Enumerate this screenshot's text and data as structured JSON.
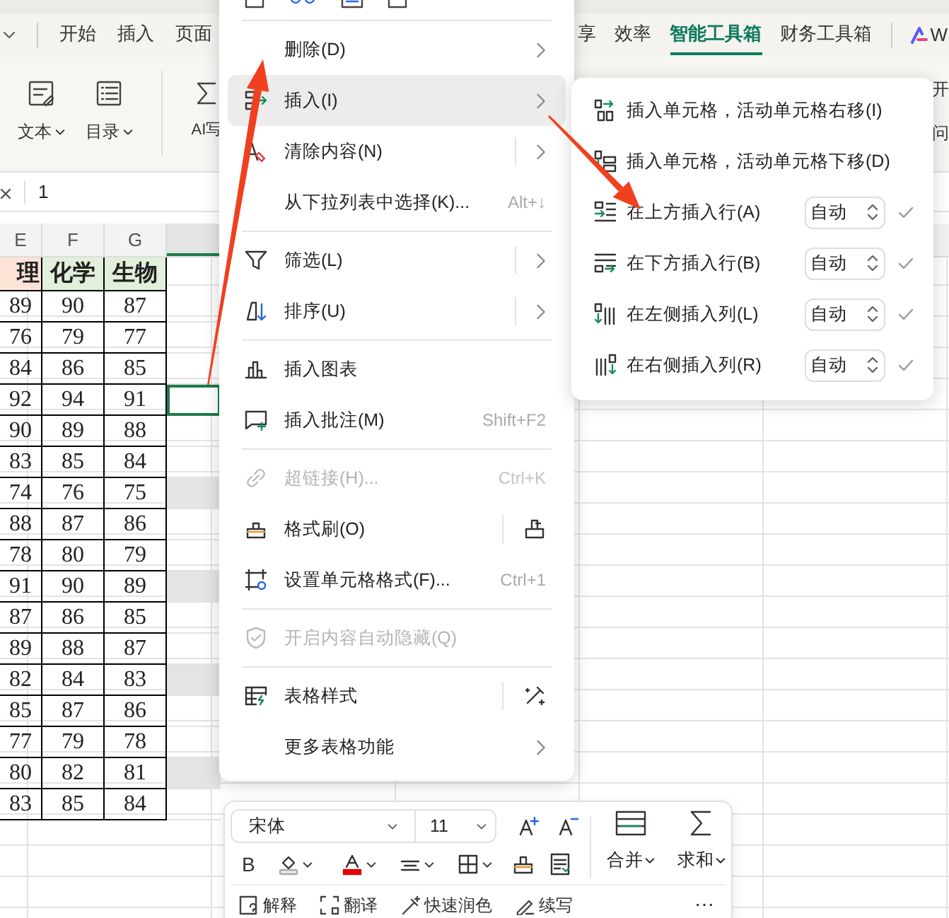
{
  "ribbon_tabs": [
    {
      "label": "开始",
      "selected": false,
      "kind": "tab"
    },
    {
      "label": "插入",
      "selected": false,
      "kind": "tab"
    },
    {
      "label": "页面",
      "selected": false,
      "kind": "tab"
    },
    {
      "label": "享",
      "selected": false,
      "kind": "tab"
    },
    {
      "label": "效率",
      "selected": false,
      "kind": "tab"
    },
    {
      "label": "智能工具箱",
      "selected": true,
      "kind": "tab"
    },
    {
      "label": "财务工具箱",
      "selected": false,
      "kind": "tab"
    },
    {
      "label": "W",
      "selected": false,
      "kind": "app"
    }
  ],
  "ribbon": {
    "buttons": [
      {
        "label": "文本",
        "dropdown": true
      },
      {
        "label": "目录",
        "dropdown": true
      },
      {
        "label": "AI写",
        "dropdown": false
      }
    ],
    "right_labels": [
      "开",
      "问"
    ]
  },
  "formula_bar": {
    "value": "1"
  },
  "sheet": {
    "columns": [
      "E",
      "F",
      "G"
    ],
    "header": [
      "理",
      "化学",
      "生物"
    ],
    "rows": [
      {
        "cells": [
          "89",
          "90",
          "87"
        ],
        "active_cell": false,
        "shaded": false
      },
      {
        "cells": [
          "76",
          "79",
          "77"
        ],
        "active_cell": false,
        "shaded": false
      },
      {
        "cells": [
          "84",
          "86",
          "85"
        ],
        "active_cell": false,
        "shaded": false
      },
      {
        "cells": [
          "92",
          "94",
          "91"
        ],
        "active_cell": true,
        "shaded": false
      },
      {
        "cells": [
          "90",
          "89",
          "88"
        ],
        "active_cell": false,
        "shaded": false
      },
      {
        "cells": [
          "83",
          "85",
          "84"
        ],
        "active_cell": false,
        "shaded": false
      },
      {
        "cells": [
          "74",
          "76",
          "75"
        ],
        "active_cell": false,
        "shaded": true
      },
      {
        "cells": [
          "88",
          "87",
          "86"
        ],
        "active_cell": false,
        "shaded": false
      },
      {
        "cells": [
          "78",
          "80",
          "79"
        ],
        "active_cell": false,
        "shaded": false
      },
      {
        "cells": [
          "91",
          "90",
          "89"
        ],
        "active_cell": false,
        "shaded": true
      },
      {
        "cells": [
          "87",
          "86",
          "85"
        ],
        "active_cell": false,
        "shaded": false
      },
      {
        "cells": [
          "89",
          "88",
          "87"
        ],
        "active_cell": false,
        "shaded": false
      },
      {
        "cells": [
          "82",
          "84",
          "83"
        ],
        "active_cell": false,
        "shaded": true
      },
      {
        "cells": [
          "85",
          "87",
          "86"
        ],
        "active_cell": false,
        "shaded": false
      },
      {
        "cells": [
          "77",
          "79",
          "78"
        ],
        "active_cell": false,
        "shaded": false
      },
      {
        "cells": [
          "80",
          "82",
          "81"
        ],
        "active_cell": false,
        "shaded": true
      },
      {
        "cells": [
          "83",
          "85",
          "84"
        ],
        "active_cell": false,
        "shaded": false
      }
    ]
  },
  "context_menu": {
    "items": [
      {
        "kind": "item",
        "label": "删除(D)",
        "submenu": true,
        "split": false,
        "selected": false,
        "disabled": false
      },
      {
        "kind": "item",
        "label": "插入(I)",
        "submenu": true,
        "split": false,
        "selected": true,
        "disabled": false
      },
      {
        "kind": "item",
        "label": "清除内容(N)",
        "submenu": true,
        "split": true,
        "selected": false,
        "disabled": false
      },
      {
        "kind": "item",
        "label": "从下拉列表中选择(K)...",
        "shortcut": "Alt+↓",
        "submenu": false,
        "split": false,
        "selected": false,
        "disabled": false
      },
      {
        "kind": "separator"
      },
      {
        "kind": "item",
        "label": "筛选(L)",
        "submenu": true,
        "split": true,
        "selected": false,
        "disabled": false
      },
      {
        "kind": "item",
        "label": "排序(U)",
        "submenu": true,
        "split": true,
        "selected": false,
        "disabled": false
      },
      {
        "kind": "separator"
      },
      {
        "kind": "item",
        "label": "插入图表",
        "submenu": false,
        "split": false,
        "selected": false,
        "disabled": false
      },
      {
        "kind": "item",
        "label": "插入批注(M)",
        "shortcut": "Shift+F2",
        "submenu": false,
        "split": false,
        "selected": false,
        "disabled": false
      },
      {
        "kind": "separator"
      },
      {
        "kind": "item",
        "label": "超链接(H)...",
        "shortcut": "Ctrl+K",
        "submenu": false,
        "split": false,
        "selected": false,
        "disabled": true
      },
      {
        "kind": "item",
        "label": "格式刷(O)",
        "submenu": false,
        "split": true,
        "side_button": true,
        "selected": false,
        "disabled": false
      },
      {
        "kind": "item",
        "label": "设置单元格格式(F)...",
        "shortcut": "Ctrl+1",
        "submenu": false,
        "split": false,
        "selected": false,
        "disabled": false
      },
      {
        "kind": "separator"
      },
      {
        "kind": "item",
        "label": "开启内容自动隐藏(Q)",
        "submenu": false,
        "split": false,
        "selected": false,
        "disabled": true
      },
      {
        "kind": "separator"
      },
      {
        "kind": "item",
        "label": "表格样式",
        "submenu": false,
        "split": true,
        "side_button": true,
        "selected": false,
        "disabled": false
      },
      {
        "kind": "item",
        "label": "更多表格功能",
        "submenu": true,
        "split": false,
        "selected": false,
        "disabled": false
      }
    ]
  },
  "submenu": {
    "items": [
      {
        "kind": "plain",
        "label": "插入单元格，活动单元格右移(I)"
      },
      {
        "kind": "plain",
        "label": "插入单元格，活动单元格下移(D)"
      },
      {
        "kind": "count",
        "label": "在上方插入行(A)",
        "value": "自动"
      },
      {
        "kind": "count",
        "label": "在下方插入行(B)",
        "value": "自动"
      },
      {
        "kind": "count",
        "label": "在左侧插入列(L)",
        "value": "自动"
      },
      {
        "kind": "count",
        "label": "在右侧插入列(R)",
        "value": "自动"
      }
    ]
  },
  "mini_toolbar": {
    "font": "宋体",
    "size": "11",
    "bold": "B",
    "merge": "合并",
    "sum": "求和",
    "actions": [
      "解释",
      "翻译",
      "快速润色",
      "续写"
    ],
    "more": "⋯"
  }
}
